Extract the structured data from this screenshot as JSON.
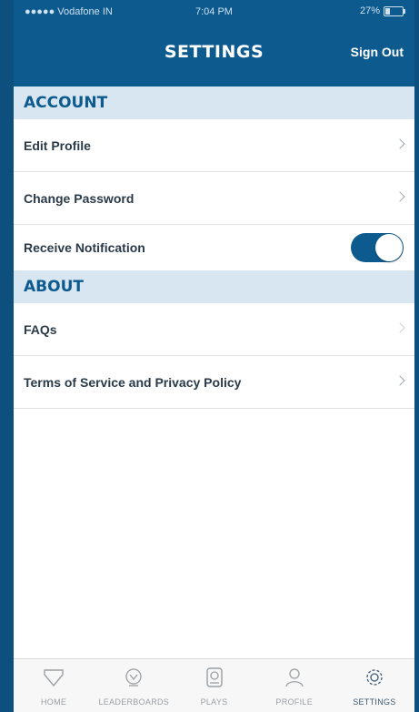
{
  "status_bar": {
    "carrier": "●●●●● Vodafone IN",
    "time": "7:04 PM",
    "battery": "27%",
    "battery_level": 0.27
  },
  "header": {
    "title": "SETTINGS",
    "sign_out_label": "Sign Out"
  },
  "account": {
    "section_title": "ACCOUNT",
    "edit_profile": "Edit Profile",
    "change_password": "Change Password",
    "receive_notification": "Receive Notification",
    "notification_enabled": true
  },
  "about": {
    "section_title": "ABOUT",
    "faqs": "FAQs",
    "terms": "Terms of Service and Privacy Policy"
  },
  "tab_bar": {
    "tabs": [
      {
        "label": "HOME",
        "icon": "home-icon"
      },
      {
        "label": "LEADERBOARDS",
        "icon": "leaderboards-icon"
      },
      {
        "label": "PLAYS",
        "icon": "plays-icon"
      },
      {
        "label": "PROFILE",
        "icon": "profile-icon"
      },
      {
        "label": "SETTINGS",
        "icon": "settings-icon"
      }
    ],
    "active": "SETTINGS"
  },
  "colors": {
    "brand_blue": "#0d5a8f",
    "section_bg": "#d7e6f0"
  }
}
